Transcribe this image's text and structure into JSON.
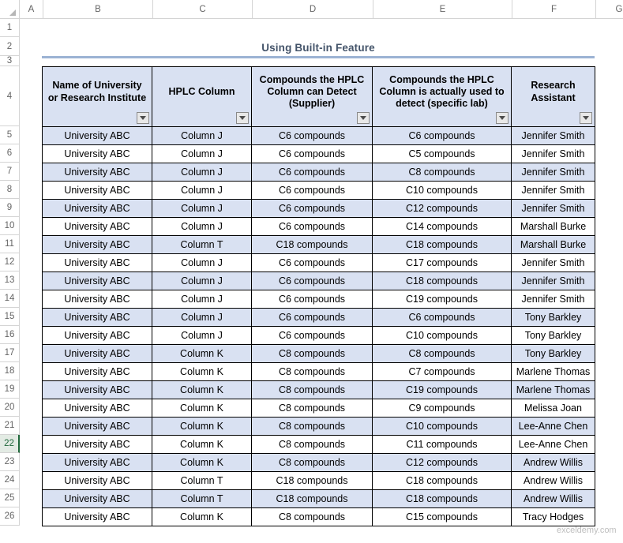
{
  "app": {
    "type": "spreadsheet",
    "corner_icon": "select-all-triangle-icon"
  },
  "grid": {
    "column_headers": [
      "A",
      "B",
      "C",
      "D",
      "E",
      "F",
      "G"
    ],
    "row_headers": [
      "1",
      "2",
      "3",
      "4",
      "5",
      "6",
      "7",
      "8",
      "9",
      "10",
      "11",
      "12",
      "13",
      "14",
      "15",
      "16",
      "17",
      "18",
      "19",
      "20",
      "21",
      "22",
      "23",
      "24",
      "25",
      "26"
    ],
    "selected_row": "22"
  },
  "title": {
    "text": "Using Built-in Feature",
    "color": "#44546a",
    "rule_color": "#9cb3d4"
  },
  "table": {
    "header_fill": "#d9e1f2",
    "band_fill": "#d9e1f2",
    "filter_icon": "filter-dropdown-icon",
    "columns": [
      "Name of University or Research Institute",
      "HPLC Column",
      "Compounds the HPLC Column can Detect (Supplier)",
      "Compounds the HPLC Column is actually used to detect (specific lab)",
      "Research Assistant"
    ],
    "has_filter": [
      true,
      true,
      true,
      true,
      true
    ],
    "rows": [
      {
        "row": "5",
        "university": "University ABC",
        "column": "Column J",
        "supplier": "C6 compounds",
        "actual": "C6 compounds",
        "assistant": "Jennifer Smith"
      },
      {
        "row": "6",
        "university": "University ABC",
        "column": "Column J",
        "supplier": "C6 compounds",
        "actual": "C5 compounds",
        "assistant": "Jennifer Smith"
      },
      {
        "row": "7",
        "university": "University ABC",
        "column": "Column J",
        "supplier": "C6 compounds",
        "actual": "C8 compounds",
        "assistant": "Jennifer Smith"
      },
      {
        "row": "8",
        "university": "University ABC",
        "column": "Column J",
        "supplier": "C6 compounds",
        "actual": "C10 compounds",
        "assistant": "Jennifer Smith"
      },
      {
        "row": "9",
        "university": "University ABC",
        "column": "Column J",
        "supplier": "C6 compounds",
        "actual": "C12 compounds",
        "assistant": "Jennifer Smith"
      },
      {
        "row": "10",
        "university": "University ABC",
        "column": "Column J",
        "supplier": "C6 compounds",
        "actual": "C14 compounds",
        "assistant": "Marshall Burke"
      },
      {
        "row": "11",
        "university": "University ABC",
        "column": "Column T",
        "supplier": "C18 compounds",
        "actual": "C18 compounds",
        "assistant": "Marshall Burke"
      },
      {
        "row": "12",
        "university": "University ABC",
        "column": "Column J",
        "supplier": "C6 compounds",
        "actual": "C17 compounds",
        "assistant": "Jennifer Smith"
      },
      {
        "row": "13",
        "university": "University ABC",
        "column": "Column J",
        "supplier": "C6 compounds",
        "actual": "C18 compounds",
        "assistant": "Jennifer Smith"
      },
      {
        "row": "14",
        "university": "University ABC",
        "column": "Column J",
        "supplier": "C6 compounds",
        "actual": "C19 compounds",
        "assistant": "Jennifer Smith"
      },
      {
        "row": "15",
        "university": "University ABC",
        "column": "Column J",
        "supplier": "C6 compounds",
        "actual": "C6 compounds",
        "assistant": "Tony Barkley"
      },
      {
        "row": "16",
        "university": "University ABC",
        "column": "Column J",
        "supplier": "C6 compounds",
        "actual": "C10 compounds",
        "assistant": "Tony Barkley"
      },
      {
        "row": "17",
        "university": "University ABC",
        "column": "Column K",
        "supplier": "C8 compounds",
        "actual": "C8 compounds",
        "assistant": "Tony Barkley"
      },
      {
        "row": "18",
        "university": "University ABC",
        "column": "Column K",
        "supplier": "C8 compounds",
        "actual": "C7 compounds",
        "assistant": "Marlene Thomas"
      },
      {
        "row": "19",
        "university": "University ABC",
        "column": "Column K",
        "supplier": "C8 compounds",
        "actual": "C19 compounds",
        "assistant": "Marlene Thomas"
      },
      {
        "row": "20",
        "university": "University ABC",
        "column": "Column K",
        "supplier": "C8 compounds",
        "actual": "C9 compounds",
        "assistant": "Melissa Joan"
      },
      {
        "row": "21",
        "university": "University ABC",
        "column": "Column K",
        "supplier": "C8 compounds",
        "actual": "C10 compounds",
        "assistant": "Lee-Anne Chen"
      },
      {
        "row": "22",
        "university": "University ABC",
        "column": "Column K",
        "supplier": "C8 compounds",
        "actual": "C11 compounds",
        "assistant": "Lee-Anne Chen"
      },
      {
        "row": "23",
        "university": "University ABC",
        "column": "Column K",
        "supplier": "C8 compounds",
        "actual": "C12 compounds",
        "assistant": "Andrew Willis"
      },
      {
        "row": "24",
        "university": "University ABC",
        "column": "Column T",
        "supplier": "C18 compounds",
        "actual": "C18 compounds",
        "assistant": "Andrew Willis"
      },
      {
        "row": "25",
        "university": "University ABC",
        "column": "Column T",
        "supplier": "C18 compounds",
        "actual": "C18 compounds",
        "assistant": "Andrew Willis"
      },
      {
        "row": "26",
        "university": "University ABC",
        "column": "Column K",
        "supplier": "C8 compounds",
        "actual": "C15 compounds",
        "assistant": "Tracy Hodges"
      }
    ]
  },
  "watermark": {
    "text": "exceldemy.com"
  }
}
